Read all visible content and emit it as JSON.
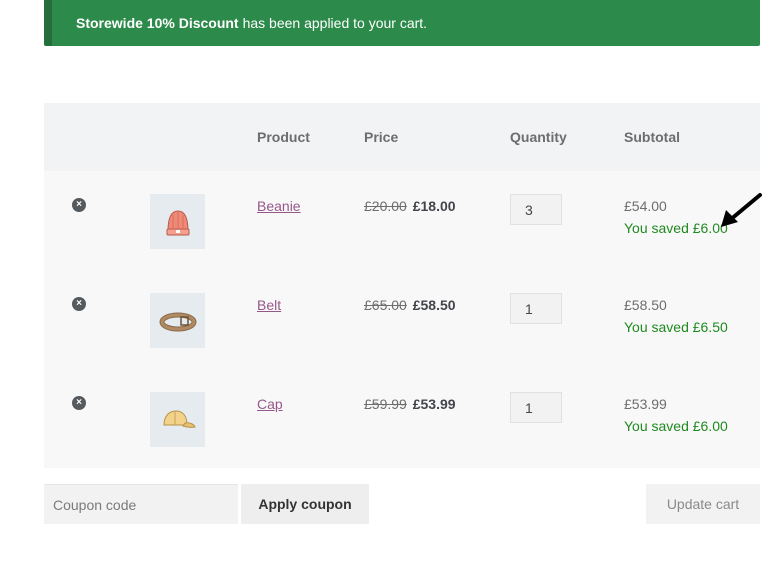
{
  "notice": {
    "bold": "Storewide 10% Discount",
    "text": "has been applied to your cart."
  },
  "cart": {
    "headers": {
      "product": "Product",
      "price": "Price",
      "quantity": "Quantity",
      "subtotal": "Subtotal"
    },
    "remove_symbol": "×",
    "items": [
      {
        "name": "Beanie",
        "price_old": "£20.00",
        "price_new": "£18.00",
        "quantity": "3",
        "subtotal": "£54.00",
        "saved": "You saved £6.00",
        "icon": "beanie-icon"
      },
      {
        "name": "Belt",
        "price_old": "£65.00",
        "price_new": "£58.50",
        "quantity": "1",
        "subtotal": "£58.50",
        "saved": "You saved £6.50",
        "icon": "belt-icon"
      },
      {
        "name": "Cap",
        "price_old": "£59.99",
        "price_new": "£53.99",
        "quantity": "1",
        "subtotal": "£53.99",
        "saved": "You saved £6.00",
        "icon": "cap-icon"
      }
    ]
  },
  "actions": {
    "coupon_placeholder": "Coupon code",
    "apply_label": "Apply coupon",
    "update_label": "Update cart"
  },
  "colors": {
    "notice_bg": "#2c8a4a",
    "link": "#96588a",
    "saved": "#1f8a1f"
  }
}
